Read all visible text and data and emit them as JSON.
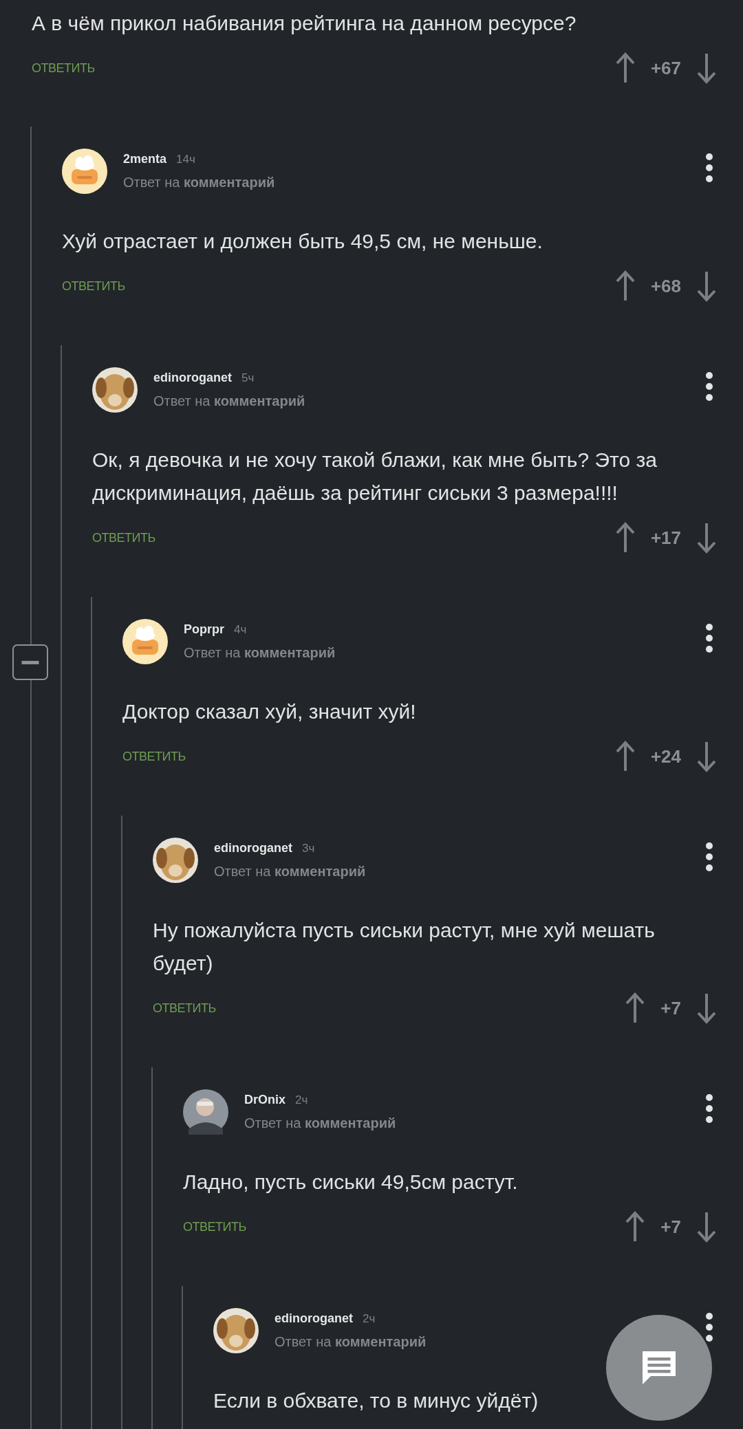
{
  "thread": {
    "text": "А в чём прикол набивания рейтинга на данном ресурсе?",
    "reply": "ОТВЕТИТЬ",
    "score": "+67",
    "expanded": true,
    "children": [
      {
        "author": "2menta",
        "time": "14ч",
        "reply_to": "Ответ на **комментарий**",
        "avatar": {
          "kind": "cartoon"
        },
        "text": "Хуй отрастает и должен быть 49,5 см, не меньше.",
        "reply": "ОТВЕТИТЬ",
        "score": "+68",
        "children": [
          {
            "author": "edinoroganet",
            "time": "5ч",
            "reply_to": "Ответ на **комментарий**",
            "avatar": {
              "kind": "animal-photo"
            },
            "text": "Ок, я девочка и не хочу такой блажи, как мне быть? Это за дискриминация, даёшь за рейтинг сиськи 3 размера!!!!",
            "reply": "ОТВЕТИТЬ",
            "score": "+17",
            "children": [
              {
                "author": "Poprpr",
                "time": "4ч",
                "reply_to": "Ответ на **комментарий**",
                "avatar": {
                  "kind": "cartoon"
                },
                "text": "Доктор сказал хуй, значит хуй!",
                "reply": "ОТВЕТИТЬ",
                "score": "+24",
                "children": [
                  {
                    "author": "edinoroganet",
                    "time": "3ч",
                    "reply_to": "Ответ на **комментарий**",
                    "avatar": {
                      "kind": "animal-photo"
                    },
                    "text": "Ну пожалуйста пусть сиськи растут, мне хуй мешать будет)",
                    "reply": "ОТВЕТИТЬ",
                    "score": "+7",
                    "children": [
                      {
                        "author": "DrOnix",
                        "time": "2ч",
                        "reply_to": "Ответ на **комментарий**",
                        "avatar": {
                          "kind": "person-photo"
                        },
                        "text": "Ладно, пусть сиськи 49,5см растут.",
                        "reply": "ОТВЕТИТЬ",
                        "score": "+7",
                        "children": [
                          {
                            "author": "edinoroganet",
                            "time": "2ч",
                            "reply_to": "Ответ на **комментарий**",
                            "avatar": {
                              "kind": "animal-photo"
                            },
                            "text": "Если в обхвате, то в минус уйдёт)"
                          }
                        ]
                      }
                    ]
                  }
                ]
              }
            ]
          }
        ]
      }
    ]
  }
}
